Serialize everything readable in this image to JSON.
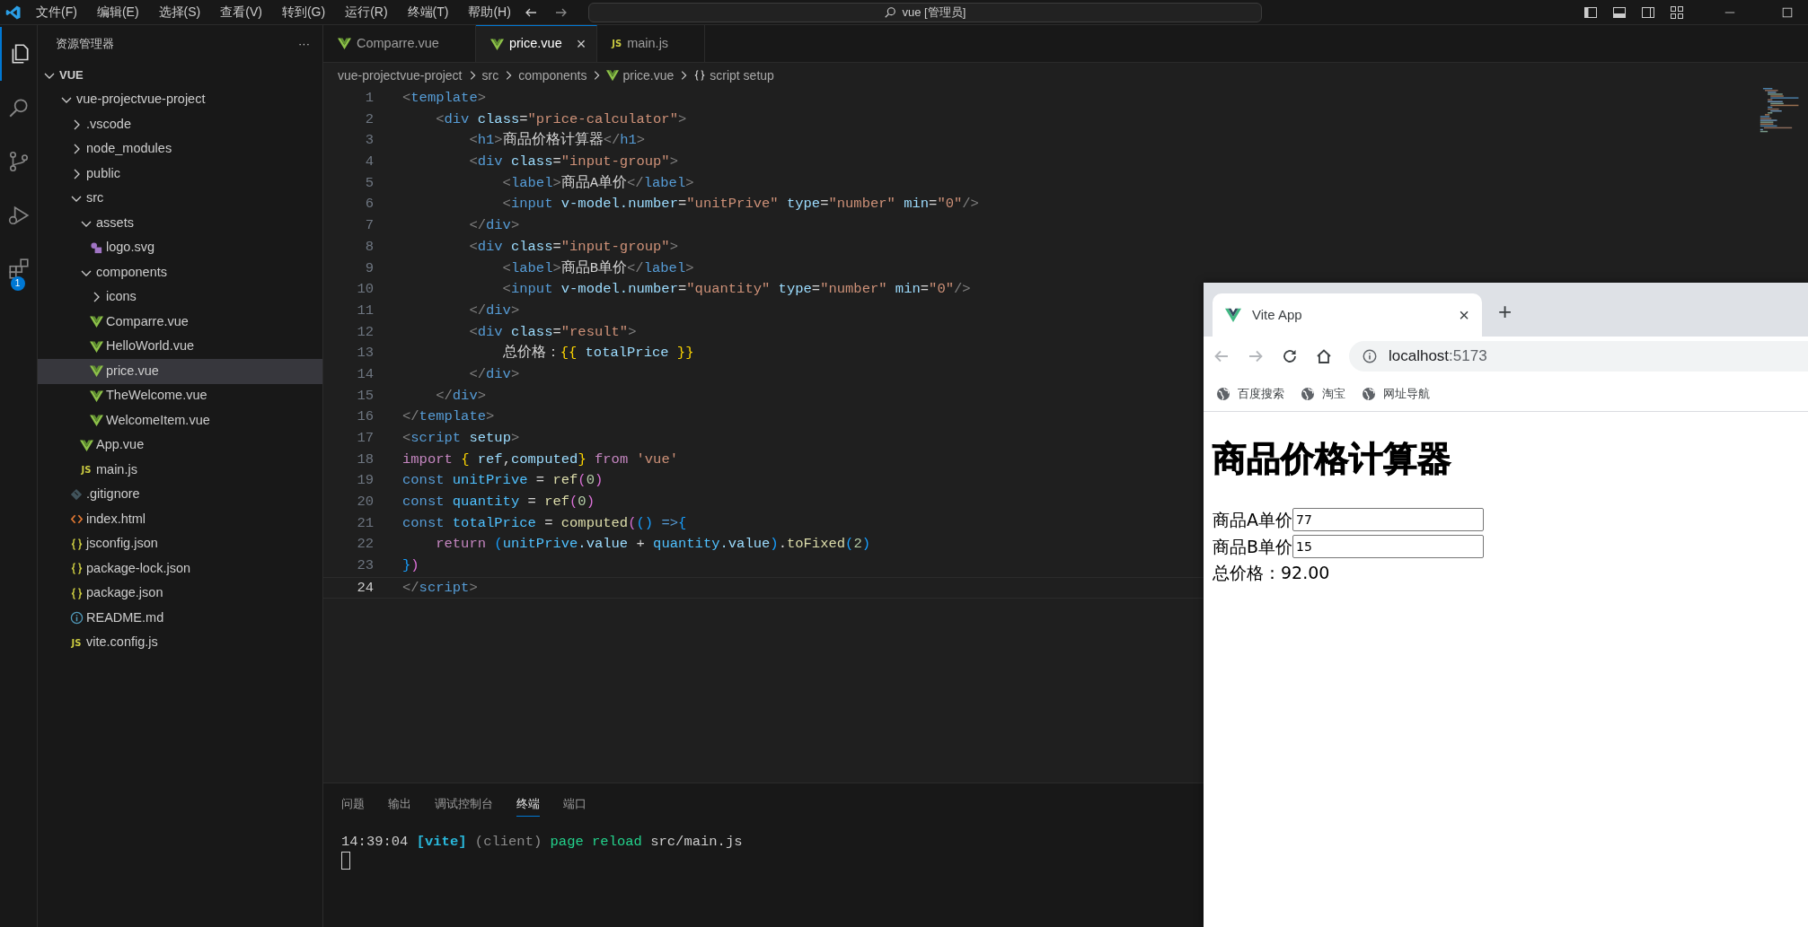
{
  "titlebar": {
    "menus": [
      "文件(F)",
      "编辑(E)",
      "选择(S)",
      "查看(V)",
      "转到(G)",
      "运行(R)",
      "终端(T)",
      "帮助(H)"
    ],
    "search": {
      "text": "vue [管理员]"
    }
  },
  "activity_bar": [
    {
      "kind": "explorer",
      "selected": true
    },
    {
      "kind": "search",
      "selected": false
    },
    {
      "kind": "source-control",
      "selected": false
    },
    {
      "kind": "run-debug",
      "selected": false
    },
    {
      "kind": "extensions",
      "selected": false,
      "badge": "1"
    }
  ],
  "explorer": {
    "title": "资源管理器",
    "more": "···",
    "section": {
      "label": "VUE",
      "expanded": true,
      "items": [
        {
          "label": "vue-projectvue-project",
          "kind": "folder",
          "expanded": true,
          "selected": false,
          "children": [
            {
              "label": ".vscode",
              "kind": "folder",
              "expanded": false,
              "selected": false
            },
            {
              "label": "node_modules",
              "kind": "folder",
              "expanded": false,
              "selected": false
            },
            {
              "label": "public",
              "kind": "folder",
              "expanded": false,
              "selected": false
            },
            {
              "label": "src",
              "kind": "folder",
              "expanded": true,
              "selected": false,
              "children": [
                {
                  "label": "assets",
                  "kind": "folder",
                  "expanded": true,
                  "selected": false,
                  "children": [
                    {
                      "label": "logo.svg",
                      "kind": "svg",
                      "selected": false
                    }
                  ]
                },
                {
                  "label": "components",
                  "kind": "folder",
                  "expanded": true,
                  "selected": false,
                  "children": [
                    {
                      "label": "icons",
                      "kind": "folder",
                      "expanded": false,
                      "selected": false
                    },
                    {
                      "label": "Comparre.vue",
                      "kind": "vue",
                      "selected": false
                    },
                    {
                      "label": "HelloWorld.vue",
                      "kind": "vue",
                      "selected": false
                    },
                    {
                      "label": "price.vue",
                      "kind": "vue",
                      "selected": true
                    },
                    {
                      "label": "TheWelcome.vue",
                      "kind": "vue",
                      "selected": false
                    },
                    {
                      "label": "WelcomeItem.vue",
                      "kind": "vue",
                      "selected": false
                    }
                  ]
                },
                {
                  "label": "App.vue",
                  "kind": "vue",
                  "selected": false
                },
                {
                  "label": "main.js",
                  "kind": "js",
                  "glyph": "JS",
                  "selected": false
                }
              ]
            },
            {
              "label": ".gitignore",
              "kind": "git",
              "selected": false
            },
            {
              "label": "index.html",
              "kind": "html",
              "selected": false
            },
            {
              "label": "jsconfig.json",
              "kind": "json",
              "selected": false
            },
            {
              "label": "package-lock.json",
              "kind": "json",
              "selected": false
            },
            {
              "label": "package.json",
              "kind": "json",
              "selected": false
            },
            {
              "label": "README.md",
              "kind": "info",
              "selected": false
            },
            {
              "label": "vite.config.js",
              "kind": "js",
              "glyph": "JS",
              "selected": false
            }
          ]
        }
      ]
    }
  },
  "editor_tabs": [
    {
      "label": "Comparre.vue",
      "kind": "vue",
      "selected": false
    },
    {
      "label": "price.vue",
      "kind": "vue",
      "selected": true,
      "close": "×"
    },
    {
      "label": "main.js",
      "kind": "js",
      "glyph": "JS",
      "selected": false
    }
  ],
  "breadcrumb": [
    {
      "label": "vue-projectvue-project",
      "kind": "folder"
    },
    {
      "label": "src",
      "kind": "folder"
    },
    {
      "label": "components",
      "kind": "folder"
    },
    {
      "label": "price.vue",
      "kind": "vue"
    },
    {
      "label": "script setup",
      "kind": "symbol"
    }
  ],
  "code": {
    "lines": [
      {
        "number": "1",
        "current": false,
        "tokens": [
          {
            "text": "<",
            "kind": "punct"
          },
          {
            "text": "template",
            "kind": "tag"
          },
          {
            "text": ">",
            "kind": "punct"
          }
        ]
      },
      {
        "number": "2",
        "current": false,
        "tokens": [
          {
            "text": "    <",
            "kind": "punct"
          },
          {
            "text": "div",
            "kind": "tag"
          },
          {
            "text": " class",
            "kind": "attr"
          },
          {
            "text": "=",
            "kind": "text"
          },
          {
            "text": "\"price-calculator\"",
            "kind": "str"
          },
          {
            "text": ">",
            "kind": "punct"
          }
        ]
      },
      {
        "number": "3",
        "current": false,
        "tokens": [
          {
            "text": "        <",
            "kind": "punct"
          },
          {
            "text": "h1",
            "kind": "tag"
          },
          {
            "text": ">",
            "kind": "punct"
          },
          {
            "text": "商品价格计算器",
            "kind": "text"
          },
          {
            "text": "</",
            "kind": "punct"
          },
          {
            "text": "h1",
            "kind": "tag"
          },
          {
            "text": ">",
            "kind": "punct"
          }
        ]
      },
      {
        "number": "4",
        "current": false,
        "tokens": [
          {
            "text": "        <",
            "kind": "punct"
          },
          {
            "text": "div",
            "kind": "tag"
          },
          {
            "text": " class",
            "kind": "attr"
          },
          {
            "text": "=",
            "kind": "text"
          },
          {
            "text": "\"input-group\"",
            "kind": "str"
          },
          {
            "text": ">",
            "kind": "punct"
          }
        ]
      },
      {
        "number": "5",
        "current": false,
        "tokens": [
          {
            "text": "            <",
            "kind": "punct"
          },
          {
            "text": "label",
            "kind": "tag"
          },
          {
            "text": ">",
            "kind": "punct"
          },
          {
            "text": "商品A单价",
            "kind": "text"
          },
          {
            "text": "</",
            "kind": "punct"
          },
          {
            "text": "label",
            "kind": "tag"
          },
          {
            "text": ">",
            "kind": "punct"
          }
        ]
      },
      {
        "number": "6",
        "current": false,
        "tokens": [
          {
            "text": "            <",
            "kind": "punct"
          },
          {
            "text": "input",
            "kind": "tag"
          },
          {
            "text": " v-model.number",
            "kind": "attr"
          },
          {
            "text": "=",
            "kind": "text"
          },
          {
            "text": "\"unitPrive\"",
            "kind": "str"
          },
          {
            "text": " type",
            "kind": "attr"
          },
          {
            "text": "=",
            "kind": "text"
          },
          {
            "text": "\"number\"",
            "kind": "str"
          },
          {
            "text": " min",
            "kind": "attr"
          },
          {
            "text": "=",
            "kind": "text"
          },
          {
            "text": "\"0\"",
            "kind": "str"
          },
          {
            "text": "/>",
            "kind": "punct"
          }
        ]
      },
      {
        "number": "7",
        "current": false,
        "tokens": [
          {
            "text": "        </",
            "kind": "punct"
          },
          {
            "text": "div",
            "kind": "tag"
          },
          {
            "text": ">",
            "kind": "punct"
          }
        ]
      },
      {
        "number": "8",
        "current": false,
        "tokens": [
          {
            "text": "        <",
            "kind": "punct"
          },
          {
            "text": "div",
            "kind": "tag"
          },
          {
            "text": " class",
            "kind": "attr"
          },
          {
            "text": "=",
            "kind": "text"
          },
          {
            "text": "\"input-group\"",
            "kind": "str"
          },
          {
            "text": ">",
            "kind": "punct"
          }
        ]
      },
      {
        "number": "9",
        "current": false,
        "tokens": [
          {
            "text": "            <",
            "kind": "punct"
          },
          {
            "text": "label",
            "kind": "tag"
          },
          {
            "text": ">",
            "kind": "punct"
          },
          {
            "text": "商品B单价",
            "kind": "text"
          },
          {
            "text": "</",
            "kind": "punct"
          },
          {
            "text": "label",
            "kind": "tag"
          },
          {
            "text": ">",
            "kind": "punct"
          }
        ]
      },
      {
        "number": "10",
        "current": false,
        "tokens": [
          {
            "text": "            <",
            "kind": "punct"
          },
          {
            "text": "input",
            "kind": "tag"
          },
          {
            "text": " v-model.number",
            "kind": "attr"
          },
          {
            "text": "=",
            "kind": "text"
          },
          {
            "text": "\"quantity\"",
            "kind": "str"
          },
          {
            "text": " type",
            "kind": "attr"
          },
          {
            "text": "=",
            "kind": "text"
          },
          {
            "text": "\"number\"",
            "kind": "str"
          },
          {
            "text": " min",
            "kind": "attr"
          },
          {
            "text": "=",
            "kind": "text"
          },
          {
            "text": "\"0\"",
            "kind": "str"
          },
          {
            "text": "/>",
            "kind": "punct"
          }
        ]
      },
      {
        "number": "11",
        "current": false,
        "tokens": [
          {
            "text": "        </",
            "kind": "punct"
          },
          {
            "text": "div",
            "kind": "tag"
          },
          {
            "text": ">",
            "kind": "punct"
          }
        ]
      },
      {
        "number": "12",
        "current": false,
        "tokens": [
          {
            "text": "        <",
            "kind": "punct"
          },
          {
            "text": "div",
            "kind": "tag"
          },
          {
            "text": " class",
            "kind": "attr"
          },
          {
            "text": "=",
            "kind": "text"
          },
          {
            "text": "\"result\"",
            "kind": "str"
          },
          {
            "text": ">",
            "kind": "punct"
          }
        ]
      },
      {
        "number": "13",
        "current": false,
        "tokens": [
          {
            "text": "            总价格：",
            "kind": "text"
          },
          {
            "text": "{{",
            "kind": "brace1"
          },
          {
            "text": " totalPrice ",
            "kind": "prop"
          },
          {
            "text": "}}",
            "kind": "brace1"
          }
        ]
      },
      {
        "number": "14",
        "current": false,
        "tokens": [
          {
            "text": "        </",
            "kind": "punct"
          },
          {
            "text": "div",
            "kind": "tag"
          },
          {
            "text": ">",
            "kind": "punct"
          }
        ]
      },
      {
        "number": "15",
        "current": false,
        "tokens": [
          {
            "text": "    </",
            "kind": "punct"
          },
          {
            "text": "div",
            "kind": "tag"
          },
          {
            "text": ">",
            "kind": "punct"
          }
        ]
      },
      {
        "number": "16",
        "current": false,
        "tokens": [
          {
            "text": "</",
            "kind": "punct"
          },
          {
            "text": "template",
            "kind": "tag"
          },
          {
            "text": ">",
            "kind": "punct"
          }
        ]
      },
      {
        "number": "17",
        "current": false,
        "tokens": [
          {
            "text": "<",
            "kind": "punct"
          },
          {
            "text": "script",
            "kind": "tag"
          },
          {
            "text": " setup",
            "kind": "attr"
          },
          {
            "text": ">",
            "kind": "punct"
          }
        ]
      },
      {
        "number": "18",
        "current": false,
        "tokens": [
          {
            "text": "import ",
            "kind": "kw"
          },
          {
            "text": "{",
            "kind": "brace1"
          },
          {
            "text": " ref",
            "kind": "prop"
          },
          {
            "text": ",",
            "kind": "text"
          },
          {
            "text": "computed",
            "kind": "prop"
          },
          {
            "text": "}",
            "kind": "brace1"
          },
          {
            "text": " from ",
            "kind": "kw"
          },
          {
            "text": "'vue'",
            "kind": "str"
          }
        ]
      },
      {
        "number": "19",
        "current": false,
        "tokens": [
          {
            "text": "const ",
            "kind": "storage"
          },
          {
            "text": "unitPrive",
            "kind": "var"
          },
          {
            "text": " = ",
            "kind": "text"
          },
          {
            "text": "ref",
            "kind": "fn"
          },
          {
            "text": "(",
            "kind": "brace2"
          },
          {
            "text": "0",
            "kind": "num"
          },
          {
            "text": ")",
            "kind": "brace2"
          }
        ]
      },
      {
        "number": "20",
        "current": false,
        "tokens": [
          {
            "text": "const ",
            "kind": "storage"
          },
          {
            "text": "quantity",
            "kind": "var"
          },
          {
            "text": " = ",
            "kind": "text"
          },
          {
            "text": "ref",
            "kind": "fn"
          },
          {
            "text": "(",
            "kind": "brace2"
          },
          {
            "text": "0",
            "kind": "num"
          },
          {
            "text": ")",
            "kind": "brace2"
          }
        ]
      },
      {
        "number": "21",
        "current": false,
        "tokens": [
          {
            "text": "const ",
            "kind": "storage"
          },
          {
            "text": "totalPrice",
            "kind": "var"
          },
          {
            "text": " = ",
            "kind": "text"
          },
          {
            "text": "computed",
            "kind": "fn"
          },
          {
            "text": "(",
            "kind": "brace2"
          },
          {
            "text": "()",
            "kind": "brace3"
          },
          {
            "text": " =>",
            "kind": "storage"
          },
          {
            "text": "{",
            "kind": "brace3"
          }
        ]
      },
      {
        "number": "22",
        "current": false,
        "tokens": [
          {
            "text": "    return ",
            "kind": "kw"
          },
          {
            "text": "(",
            "kind": "brace3"
          },
          {
            "text": "unitPrive",
            "kind": "var"
          },
          {
            "text": ".value",
            "kind": "prop"
          },
          {
            "text": " + ",
            "kind": "text"
          },
          {
            "text": "quantity",
            "kind": "var"
          },
          {
            "text": ".value",
            "kind": "prop"
          },
          {
            "text": ")",
            "kind": "brace3"
          },
          {
            "text": ".",
            "kind": "text"
          },
          {
            "text": "toFixed",
            "kind": "fn"
          },
          {
            "text": "(",
            "kind": "brace3"
          },
          {
            "text": "2",
            "kind": "num"
          },
          {
            "text": ")",
            "kind": "brace3"
          }
        ]
      },
      {
        "number": "23",
        "current": false,
        "tokens": [
          {
            "text": "}",
            "kind": "brace3"
          },
          {
            "text": ")",
            "kind": "brace2"
          }
        ]
      },
      {
        "number": "24",
        "current": true,
        "tokens": [
          {
            "text": "</",
            "kind": "punct"
          },
          {
            "text": "script",
            "kind": "tag"
          },
          {
            "text": ">",
            "kind": "punct"
          }
        ]
      }
    ]
  },
  "panel": {
    "tabs": [
      {
        "label": "问题",
        "selected": false
      },
      {
        "label": "输出",
        "selected": false
      },
      {
        "label": "调试控制台",
        "selected": false
      },
      {
        "label": "终端",
        "selected": true
      },
      {
        "label": "端口",
        "selected": false
      }
    ],
    "terminal": [
      {
        "text": "14:39:04 ",
        "kind": "text"
      },
      {
        "text": "[vite]",
        "kind": "tag"
      },
      {
        "text": " (client) ",
        "kind": "muted"
      },
      {
        "text": "page reload",
        "kind": "ok"
      },
      {
        "text": " src/main.js",
        "kind": "text"
      }
    ]
  },
  "browser": {
    "tab": {
      "title": "Vite App",
      "close": "×"
    },
    "new_tab": "+",
    "nav": [
      {
        "kind": "back",
        "disabled": true
      },
      {
        "kind": "forward",
        "disabled": true
      },
      {
        "kind": "reload",
        "disabled": false
      },
      {
        "kind": "home",
        "disabled": false
      }
    ],
    "address": {
      "host": "localhost",
      "port": ":5173"
    },
    "bookmarks": [
      "百度搜索",
      "淘宝",
      "网址导航"
    ],
    "page": {
      "heading": "商品价格计算器",
      "fields": [
        {
          "label": "商品A单价",
          "value": "77"
        },
        {
          "label": "商品B单价",
          "value": "15"
        }
      ],
      "result": "总价格：92.00"
    }
  }
}
